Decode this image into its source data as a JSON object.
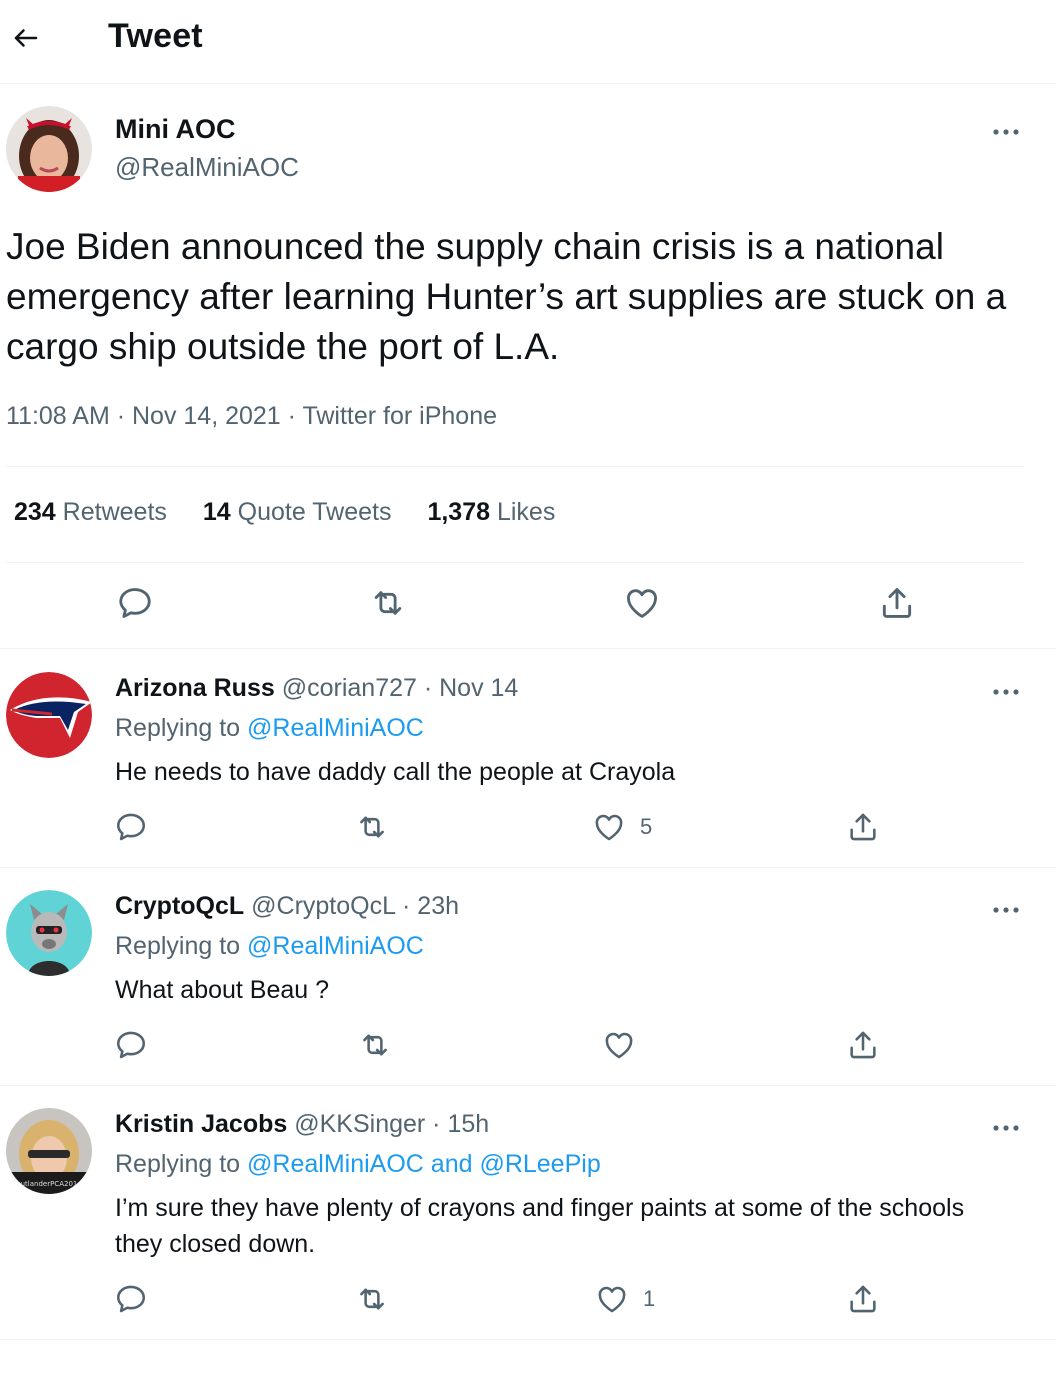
{
  "header": {
    "title": "Tweet"
  },
  "tweet": {
    "name": "Mini AOC",
    "handle": "@RealMiniAOC",
    "text": "Joe Biden announced the supply chain crisis is a national emergency after learning Hunter’s art supplies are stuck on a cargo ship outside the port of L.A.",
    "meta": "11:08 AM · Nov 14, 2021 · Twitter for iPhone",
    "retweets": "234",
    "retweets_label": "Retweets",
    "quotes": "14",
    "quotes_label": "Quote Tweets",
    "likes": "1,378",
    "likes_label": "Likes"
  },
  "replies": [
    {
      "name": "Arizona Russ",
      "handle_time": "@corian727 · Nov 14",
      "replying_label": "Replying to",
      "replying_to": "@RealMiniAOC",
      "text": "He needs to have daddy call the people at Crayola",
      "like_count": "5"
    },
    {
      "name": "CryptoQcL",
      "handle_time": "@CryptoQcL · 23h",
      "replying_label": "Replying to",
      "replying_to": "@RealMiniAOC",
      "text": "What about Beau ?",
      "like_count": ""
    },
    {
      "name": "Kristin Jacobs",
      "handle_time": "@KKSinger · 15h",
      "replying_label": "Replying to",
      "replying_to": "@RealMiniAOC and @RLeePip",
      "text": "I’m sure they have plenty of crayons and finger paints at some of the schools they closed down.",
      "like_count": "1",
      "avatar_text": "utlanderPCA201"
    }
  ],
  "colors": {
    "accent": "#1d9bf0",
    "text": "#0f1419",
    "secondary": "#536471",
    "border": "#eff3f4"
  },
  "icons": [
    "back-arrow-icon",
    "more-icon",
    "reply-icon",
    "retweet-icon",
    "like-icon",
    "share-icon"
  ]
}
